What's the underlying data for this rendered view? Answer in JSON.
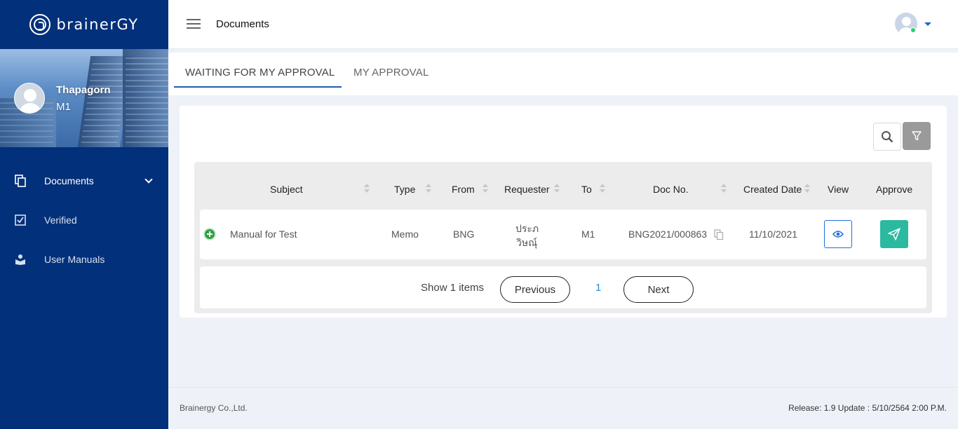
{
  "brand": {
    "name": "brainerGY"
  },
  "profile": {
    "name": "Thapagorn",
    "role": "M1"
  },
  "sidebar": {
    "items": [
      {
        "label": "Documents",
        "icon": "documents-icon"
      },
      {
        "label": "Verified",
        "icon": "checkbox-icon"
      },
      {
        "label": "User Manuals",
        "icon": "book-user-icon"
      }
    ]
  },
  "header": {
    "title": "Documents"
  },
  "tabs": [
    {
      "label": "WAITING FOR MY APPROVAL",
      "active": true
    },
    {
      "label": "MY APPROVAL",
      "active": false
    }
  ],
  "table": {
    "columns": [
      "Subject",
      "Type",
      "From",
      "Requester",
      "To",
      "Doc No.",
      "Created Date",
      "View",
      "Approve"
    ],
    "rows": [
      {
        "subject": "Manual for Test",
        "type": "Memo",
        "from": "BNG",
        "requester_line1": "ประภ",
        "requester_line2": "วิษณุ์",
        "to": "M1",
        "doc_no": "BNG2021/000863",
        "created_date": "11/10/2021"
      }
    ]
  },
  "pagination": {
    "show_text": "Show 1 items",
    "previous": "Previous",
    "next": "Next",
    "current_page": "1"
  },
  "footer": {
    "company": "Brainergy Co.,Ltd.",
    "release": "Release: 1.9 Update : 5/10/2564 2:00 P.M."
  },
  "colors": {
    "sidebar_bg": "#03307a",
    "tab_underline": "#1e5fb0",
    "approve": "#2bb9a0",
    "view_border": "#1e6fd9",
    "page_link": "#2b8bd6",
    "online": "#2ecc71"
  }
}
